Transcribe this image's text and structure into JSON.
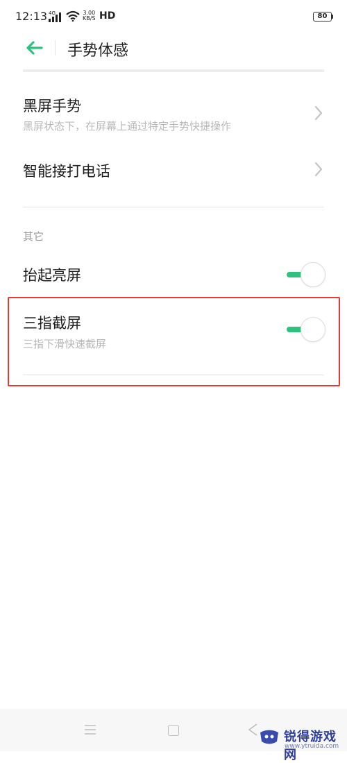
{
  "status_bar": {
    "time": "12:13",
    "network": "4G",
    "speed_value": "3.00",
    "speed_unit": "KB/S",
    "hd": "HD",
    "battery": "80"
  },
  "header": {
    "title": "手势体感"
  },
  "rows": {
    "black_screen": {
      "title": "黑屏手势",
      "subtitle": "黑屏状态下，在屏幕上通过特定手势快捷操作"
    },
    "smart_call": {
      "title": "智能接打电话"
    }
  },
  "section": {
    "other_label": "其它"
  },
  "toggles": {
    "raise_to_wake": {
      "title": "抬起亮屏",
      "enabled": true
    },
    "three_finger_screenshot": {
      "title": "三指截屏",
      "subtitle": "三指下滑快速截屏",
      "enabled": true
    }
  },
  "watermark": {
    "name": "锐得游戏网",
    "url": "www.ytruida.com"
  },
  "colors": {
    "accent": "#2ec27e",
    "highlight": "#e53935"
  }
}
